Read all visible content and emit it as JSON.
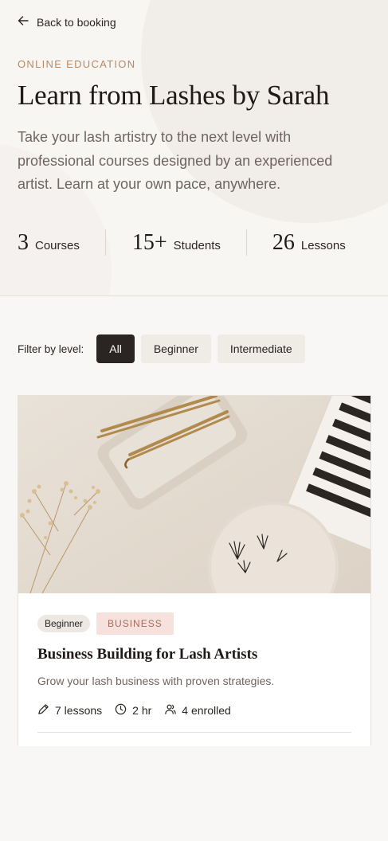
{
  "nav": {
    "back_label": "Back to booking"
  },
  "hero": {
    "eyebrow": "ONLINE EDUCATION",
    "title": "Learn from Lashes by Sarah",
    "description": "Take your lash artistry to the next level with professional courses designed by an experienced artist. Learn at your own pace, anywhere.",
    "stats": [
      {
        "value": "3",
        "label": "Courses"
      },
      {
        "value": "15+",
        "label": "Students"
      },
      {
        "value": "26",
        "label": "Lessons"
      }
    ]
  },
  "filters": {
    "label": "Filter by level:",
    "options": [
      "All",
      "Beginner",
      "Intermediate"
    ],
    "selected": "All"
  },
  "courses": [
    {
      "level": "Beginner",
      "category": "BUSINESS",
      "title": "Business Building for Lash Artists",
      "description": "Grow your lash business with proven strategies.",
      "lessons": "7 lessons",
      "duration": "2 hr",
      "enrolled": "4 enrolled"
    }
  ],
  "colors": {
    "accent": "#b88a63",
    "active_chip": "#2a2522",
    "category_tag_bg": "#f6e1dc"
  }
}
